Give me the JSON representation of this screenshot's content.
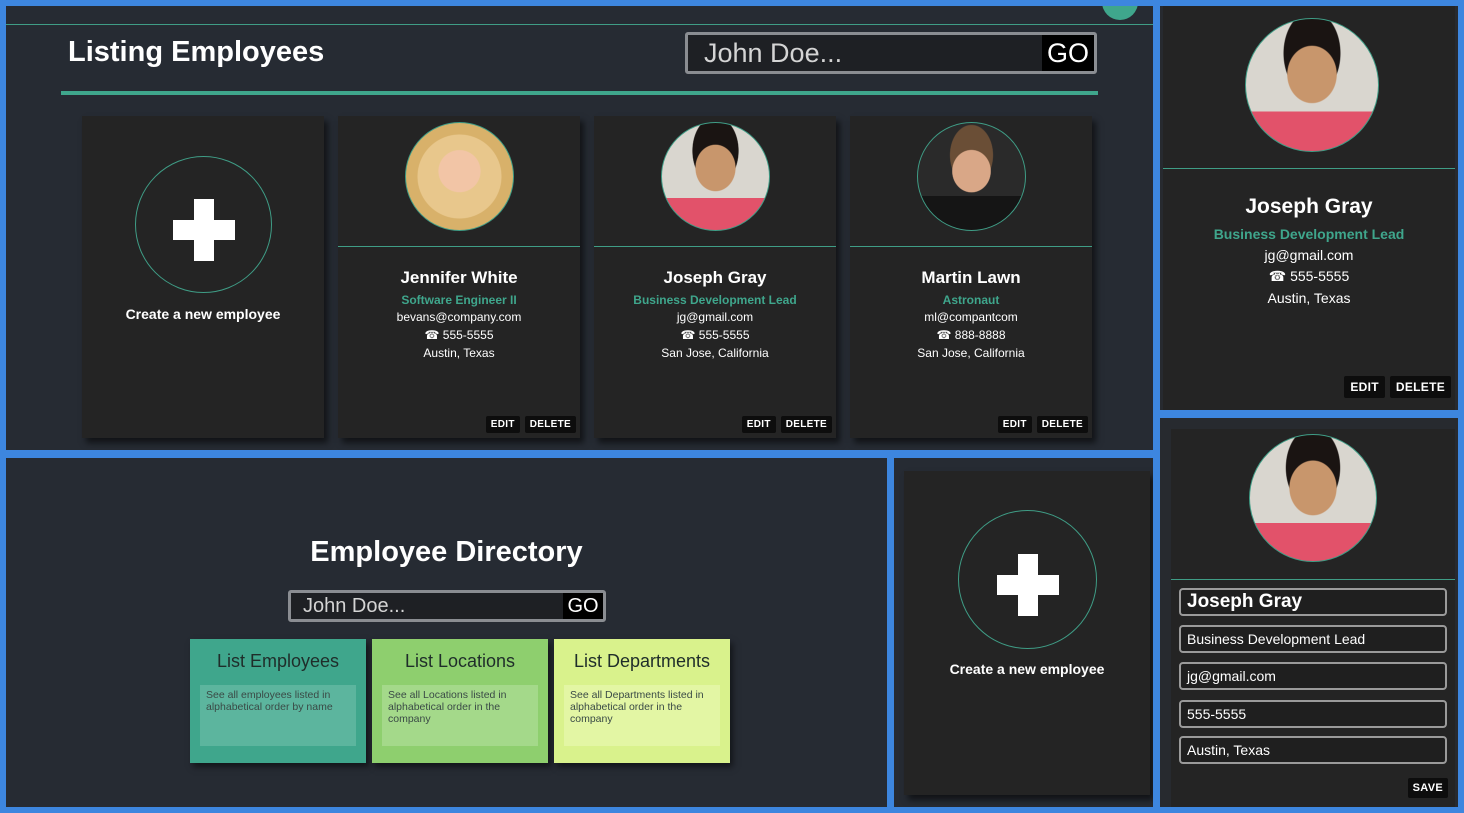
{
  "listing": {
    "title": "Listing Employees",
    "search": {
      "placeholder": "John Doe...",
      "go_label": "GO"
    },
    "create_label": "Create a new employee",
    "employees": [
      {
        "name": "Jennifer White",
        "title": "Software Engineer II",
        "email": "bevans@company.com",
        "phone": "☎ 555-5555",
        "location": "Austin, Texas",
        "edit": "EDIT",
        "delete": "DELETE"
      },
      {
        "name": "Joseph Gray",
        "title": "Business Development Lead",
        "email": "jg@gmail.com",
        "phone": "☎ 555-5555",
        "location": "San Jose, California",
        "edit": "EDIT",
        "delete": "DELETE"
      },
      {
        "name": "Martin Lawn",
        "title": "Astronaut",
        "email": "ml@compantcom",
        "phone": "☎ 888-8888",
        "location": "San Jose, California",
        "edit": "EDIT",
        "delete": "DELETE"
      }
    ]
  },
  "detail": {
    "name": "Joseph Gray",
    "title": "Business Development Lead",
    "email": "jg@gmail.com",
    "phone": "☎ 555-5555",
    "location": "Austin, Texas",
    "edit": "EDIT",
    "delete": "DELETE"
  },
  "directory": {
    "title": "Employee Directory",
    "search": {
      "placeholder": "John Doe...",
      "go_label": "GO"
    },
    "tiles": [
      {
        "title": "List Employees",
        "desc": "See all employees listed in alphabetical order by name"
      },
      {
        "title": "List Locations",
        "desc": "See all Locations listed in alphabetical order in the company"
      },
      {
        "title": "List Departments",
        "desc": "See all Departments listed in alphabetical order in the company"
      }
    ]
  },
  "create": {
    "label": "Create a new employee"
  },
  "edit_form": {
    "name": "Joseph Gray",
    "title": "Business Development Lead",
    "email": "jg@gmail.com",
    "phone": "555-5555",
    "location": "Austin, Texas",
    "save": "SAVE"
  },
  "colors": {
    "accent": "#3fa68c",
    "frame": "#3d86df",
    "panel_bg": "#262b33",
    "card_bg": "#242424"
  }
}
